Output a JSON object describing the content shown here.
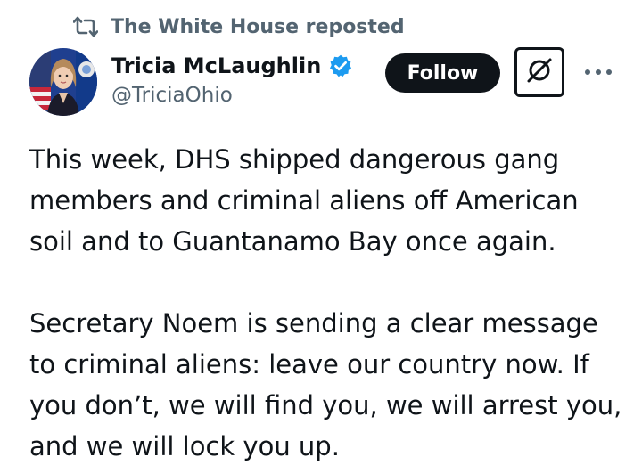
{
  "repost": {
    "icon": "repost-icon",
    "text": "The White House reposted"
  },
  "author": {
    "avatar_icon": "profile-photo",
    "name": "Tricia McLaughlin",
    "verified_icon": "verified-badge-icon",
    "handle": "@TriciaOhio"
  },
  "actions": {
    "follow_label": "Follow",
    "grok_icon": "grok-icon",
    "more_icon": "more-dots-icon"
  },
  "tweet": {
    "paragraphs": [
      "This week, DHS shipped dangerous gang members and criminal aliens off American soil and to Guantanamo Bay once again.",
      "Secretary Noem is sending a clear message to criminal aliens: leave our country now. If you don’t, we will find you, we will arrest you, and we will lock you up."
    ]
  },
  "colors": {
    "text": "#0f1419",
    "secondary": "#536471",
    "verified": "#1d9bf0",
    "button_bg": "#0f1419"
  }
}
